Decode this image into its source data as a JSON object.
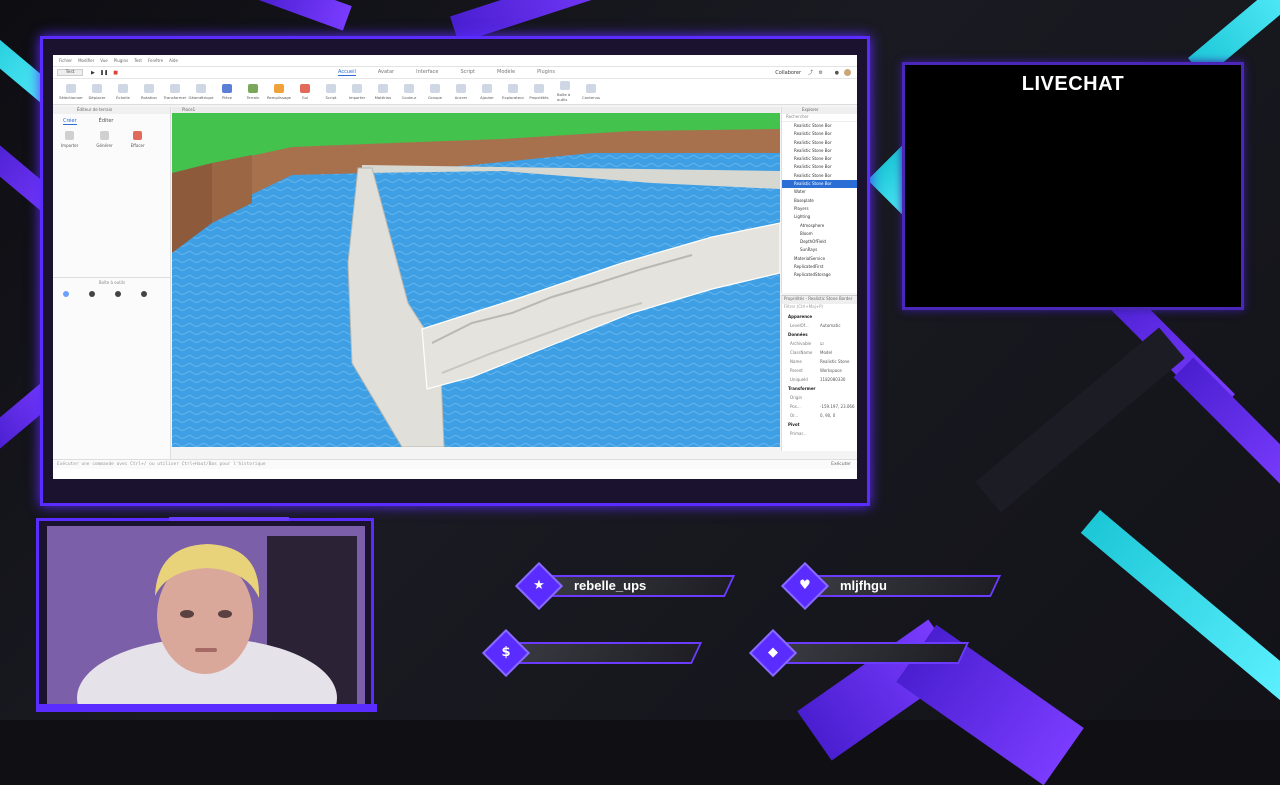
{
  "studio": {
    "menu": [
      "Fichier",
      "Modifier",
      "Vue",
      "Plugins",
      "Test",
      "Fenêtre",
      "Aide"
    ],
    "mode": "Test",
    "tabs": [
      "Accueil",
      "Avatar",
      "Interface",
      "Script",
      "Modèle",
      "Plugins"
    ],
    "collaborate": "Collaborer",
    "ribbon_tools": [
      "Sélectionner",
      "Déplacer",
      "Échelle",
      "Rotation",
      "Transformer",
      "Géométrique",
      "Pièce",
      "Terrain",
      "Remplissage",
      "Gui",
      "Script",
      "Importer",
      "Matériau",
      "Couleur",
      "Groupe",
      "Ancrer",
      "Ajouter",
      "Explorateur",
      "Propriétés",
      "Boîte à outils",
      "Contenus"
    ],
    "terrain_editor_title": "Éditeur de terrain",
    "terrain_tabs": [
      "Créer",
      "Éditer"
    ],
    "terrain_tools": [
      "Importer",
      "Générer",
      "Effacer"
    ],
    "toolbox_title": "Boîte à outils",
    "viewport_tab": "Place1",
    "explorer": {
      "title": "Explorer",
      "search": "Rechercher",
      "rows": [
        {
          "label": "Realistic Stone Bor",
          "sel": false
        },
        {
          "label": "Realistic Stone Bor",
          "sel": false
        },
        {
          "label": "Realistic Stone Bor",
          "sel": false
        },
        {
          "label": "Realistic Stone Bor",
          "sel": false
        },
        {
          "label": "Realistic Stone Bor",
          "sel": false
        },
        {
          "label": "Realistic Stone Bor",
          "sel": false
        },
        {
          "label": "Realistic Stone Bor",
          "sel": false
        },
        {
          "label": "Realistic Stone Bor",
          "sel": true
        },
        {
          "label": "Water",
          "sel": false
        },
        {
          "label": "Baseplate",
          "sel": false
        },
        {
          "label": "Players",
          "sel": false
        },
        {
          "label": "Lighting",
          "sel": false
        },
        {
          "label": "Atmosphere",
          "sel": false
        },
        {
          "label": "Bloom",
          "sel": false
        },
        {
          "label": "DepthOfField",
          "sel": false
        },
        {
          "label": "SunRays",
          "sel": false
        },
        {
          "label": "MaterialService",
          "sel": false
        },
        {
          "label": "ReplicatedFirst",
          "sel": false
        },
        {
          "label": "ReplicatedStorage",
          "sel": false
        }
      ]
    },
    "properties": {
      "title": "Propriétés - Realistic Stone Border",
      "filter": "Filtrer (Ctrl+Maj+P)",
      "sections": [
        {
          "name": "Apparence",
          "rows": [
            {
              "k": "LevelOf...",
              "v": "Automatic"
            }
          ]
        },
        {
          "name": "Données",
          "rows": [
            {
              "k": "Archivable",
              "v": "☑"
            },
            {
              "k": "ClassName",
              "v": "Model"
            },
            {
              "k": "Name",
              "v": "Realistic Stone"
            },
            {
              "k": "Parent",
              "v": "Workspace"
            },
            {
              "k": "UniqueId",
              "v": "1182080330"
            }
          ]
        },
        {
          "name": "Transformer",
          "rows": [
            {
              "k": "Origin",
              "v": ""
            },
            {
              "k": "Pos...",
              "v": "-159.197, 23.066"
            },
            {
              "k": "Or...",
              "v": "0, 90, 0"
            }
          ]
        },
        {
          "name": "Pivot",
          "rows": [
            {
              "k": "Primar...",
              "v": ""
            }
          ]
        }
      ]
    },
    "command_placeholder": "Exécuter une commande avec Ctrl+/ ou utiliser Ctrl+Haut/Bas pour l'historique",
    "command_run": "Exécuter"
  },
  "livechat": {
    "title": "LIVECHAT"
  },
  "alerts": [
    {
      "icon": "star-icon",
      "glyph": "★",
      "name": "rebelle_ups"
    },
    {
      "icon": "heart-icon",
      "glyph": "♥",
      "name": "mljfhgu"
    },
    {
      "icon": "dollar-icon",
      "glyph": "$",
      "name": ""
    },
    {
      "icon": "diamond-icon",
      "glyph": "◆",
      "name": ""
    }
  ],
  "colors": {
    "accent_purple": "#5b2cff",
    "accent_cyan": "#2fd8e6",
    "water": "#3d9fe6",
    "stone": "#d8d8d4",
    "grass": "#3fb54a"
  }
}
